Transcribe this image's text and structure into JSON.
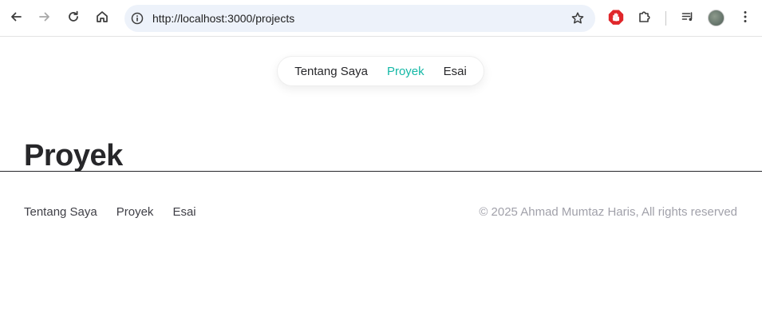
{
  "browser": {
    "url": "http://localhost:3000/projects",
    "icons": {
      "back": "arrow-left-icon",
      "forward": "arrow-right-icon",
      "reload": "reload-icon",
      "home": "home-icon",
      "site_info": "info-icon",
      "bookmark": "star-icon",
      "extension_adblock": "stop-hand-icon",
      "extensions": "puzzle-icon",
      "media": "media-queue-icon",
      "menu": "kebab-menu-icon"
    }
  },
  "nav": {
    "items": [
      {
        "label": "Tentang Saya",
        "active": false
      },
      {
        "label": "Proyek",
        "active": true
      },
      {
        "label": "Esai",
        "active": false
      }
    ]
  },
  "page": {
    "title": "Proyek"
  },
  "footer": {
    "links": [
      {
        "label": "Tentang Saya"
      },
      {
        "label": "Proyek"
      },
      {
        "label": "Esai"
      }
    ],
    "copyright": "© 2025 Ahmad Mumtaz Haris, All rights reserved"
  },
  "colors": {
    "accent": "#14b8a6",
    "text": "#27272a",
    "muted": "#a1a1aa",
    "omnibox_bg": "#edf2fa"
  }
}
